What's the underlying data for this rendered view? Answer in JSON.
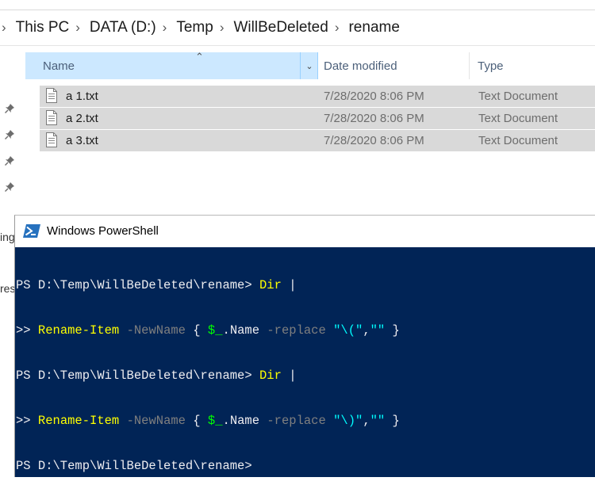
{
  "explorer": {
    "breadcrumb": [
      "This PC",
      "DATA (D:)",
      "Temp",
      "WillBeDeleted",
      "rename"
    ],
    "columns": {
      "name": "Name",
      "date": "Date modified",
      "type": "Type"
    },
    "files": [
      {
        "name": "a 1.txt",
        "date": "7/28/2020 8:06 PM",
        "type": "Text Document"
      },
      {
        "name": "a 2.txt",
        "date": "7/28/2020 8:06 PM",
        "type": "Text Document"
      },
      {
        "name": "a 3.txt",
        "date": "7/28/2020 8:06 PM",
        "type": "Text Document"
      }
    ],
    "sidebar_fragments": [
      "ing",
      "res"
    ]
  },
  "powershell": {
    "title": "Windows PowerShell",
    "lines": [
      {
        "prompt": "PS D:\\Temp\\WillBeDeleted\\rename>",
        "cmd": "Dir",
        "pipe": "|"
      },
      {
        "cont": ">>",
        "cmd": "Rename-Item",
        "param": "-NewName",
        "brace_open": "{",
        "var": "$_",
        "prop": ".Name",
        "param2": "-replace",
        "arg1": "\"\\(\"",
        "comma": ",",
        "arg2": "\"\"",
        "brace_close": "}"
      },
      {
        "prompt": "PS D:\\Temp\\WillBeDeleted\\rename>",
        "cmd": "Dir",
        "pipe": "|"
      },
      {
        "cont": ">>",
        "cmd": "Rename-Item",
        "param": "-NewName",
        "brace_open": "{",
        "var": "$_",
        "prop": ".Name",
        "param2": "-replace",
        "arg1": "\"\\)\"",
        "comma": ",",
        "arg2": "\"\"",
        "brace_close": "}"
      },
      {
        "prompt": "PS D:\\Temp\\WillBeDeleted\\rename>"
      }
    ]
  },
  "colors": {
    "console_bg": "#012456",
    "selected_header": "#cce8ff",
    "selected_row": "#d9d9d9"
  }
}
